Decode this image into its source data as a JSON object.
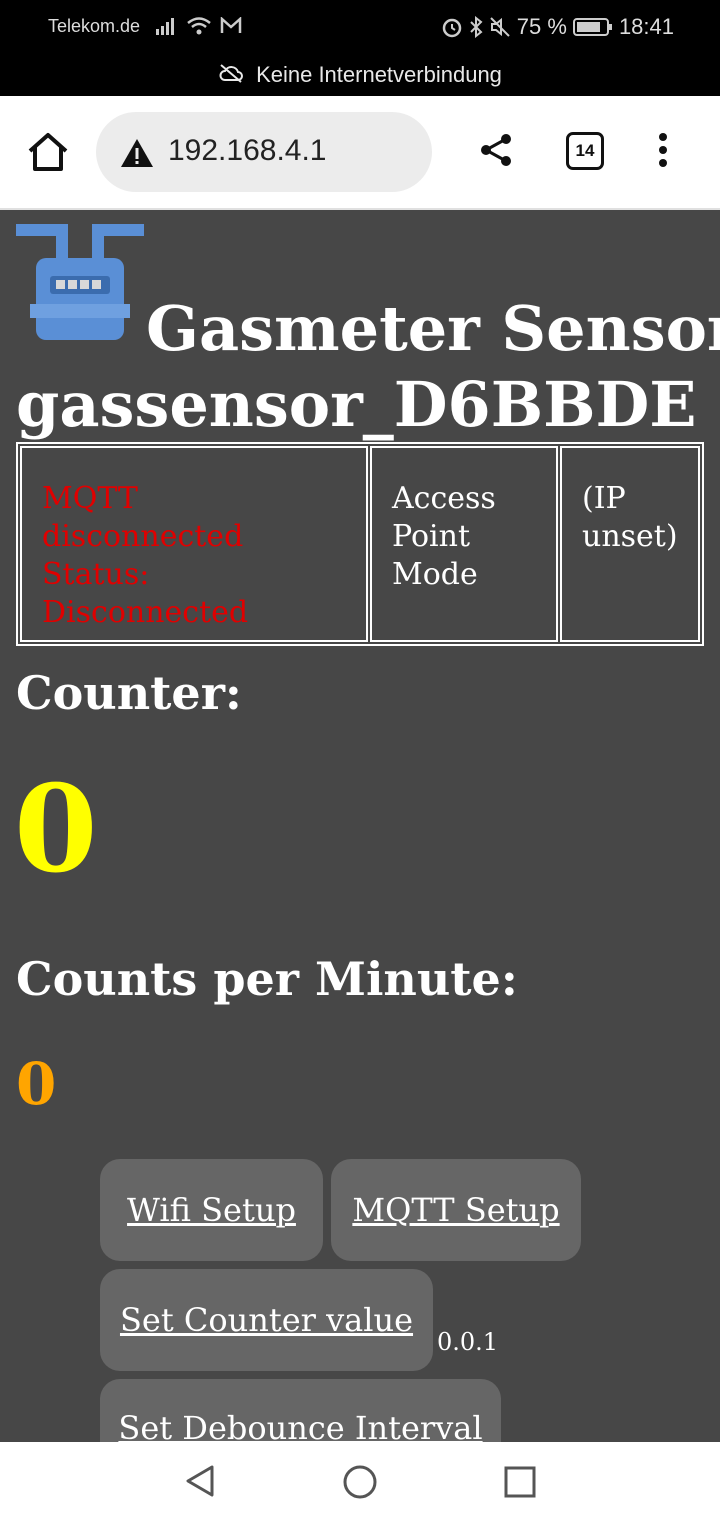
{
  "status_bar": {
    "carrier": "Telekom.de",
    "battery": "75 %",
    "time": "18:41",
    "notice": "Keine Internetverbindung"
  },
  "browser": {
    "url": "192.168.4.1",
    "tab_count": "14"
  },
  "page": {
    "title_line1": "Gasmeter Sensor",
    "title_line2": "gassensor_D6BBDE",
    "status_table": {
      "mqtt_line1": "MQTT disconnected",
      "mqtt_line2": "Status:",
      "mqtt_line3": "Disconnected",
      "mode_line1": "Access",
      "mode_line2": "Point",
      "mode_line3": "Mode",
      "ip_line1": "(IP",
      "ip_line2": "unset)"
    },
    "counter_label": "Counter:",
    "counter_value": "0",
    "cpm_label": "Counts per Minute:",
    "cpm_value": "0",
    "buttons": {
      "wifi_setup": "Wifi Setup",
      "mqtt_setup": "MQTT Setup",
      "set_counter": "Set Counter value",
      "set_debounce": "Set Debounce Interval"
    },
    "version": "0.0.1"
  },
  "colors": {
    "page_bg": "#474747",
    "error_red": "#e00000",
    "counter_yellow": "#ffff00",
    "cpm_orange": "#ffa500",
    "button_bg": "#666666"
  },
  "icons": [
    "signal-icon",
    "wifi-icon",
    "mail-icon",
    "alarm-icon",
    "bluetooth-icon",
    "mute-icon",
    "battery-icon",
    "cloud-off-icon",
    "home-icon",
    "warning-icon",
    "share-icon",
    "tabs-icon",
    "more-menu-icon",
    "gasmeter-logo",
    "back-icon",
    "home-circle-icon",
    "recents-icon"
  ]
}
